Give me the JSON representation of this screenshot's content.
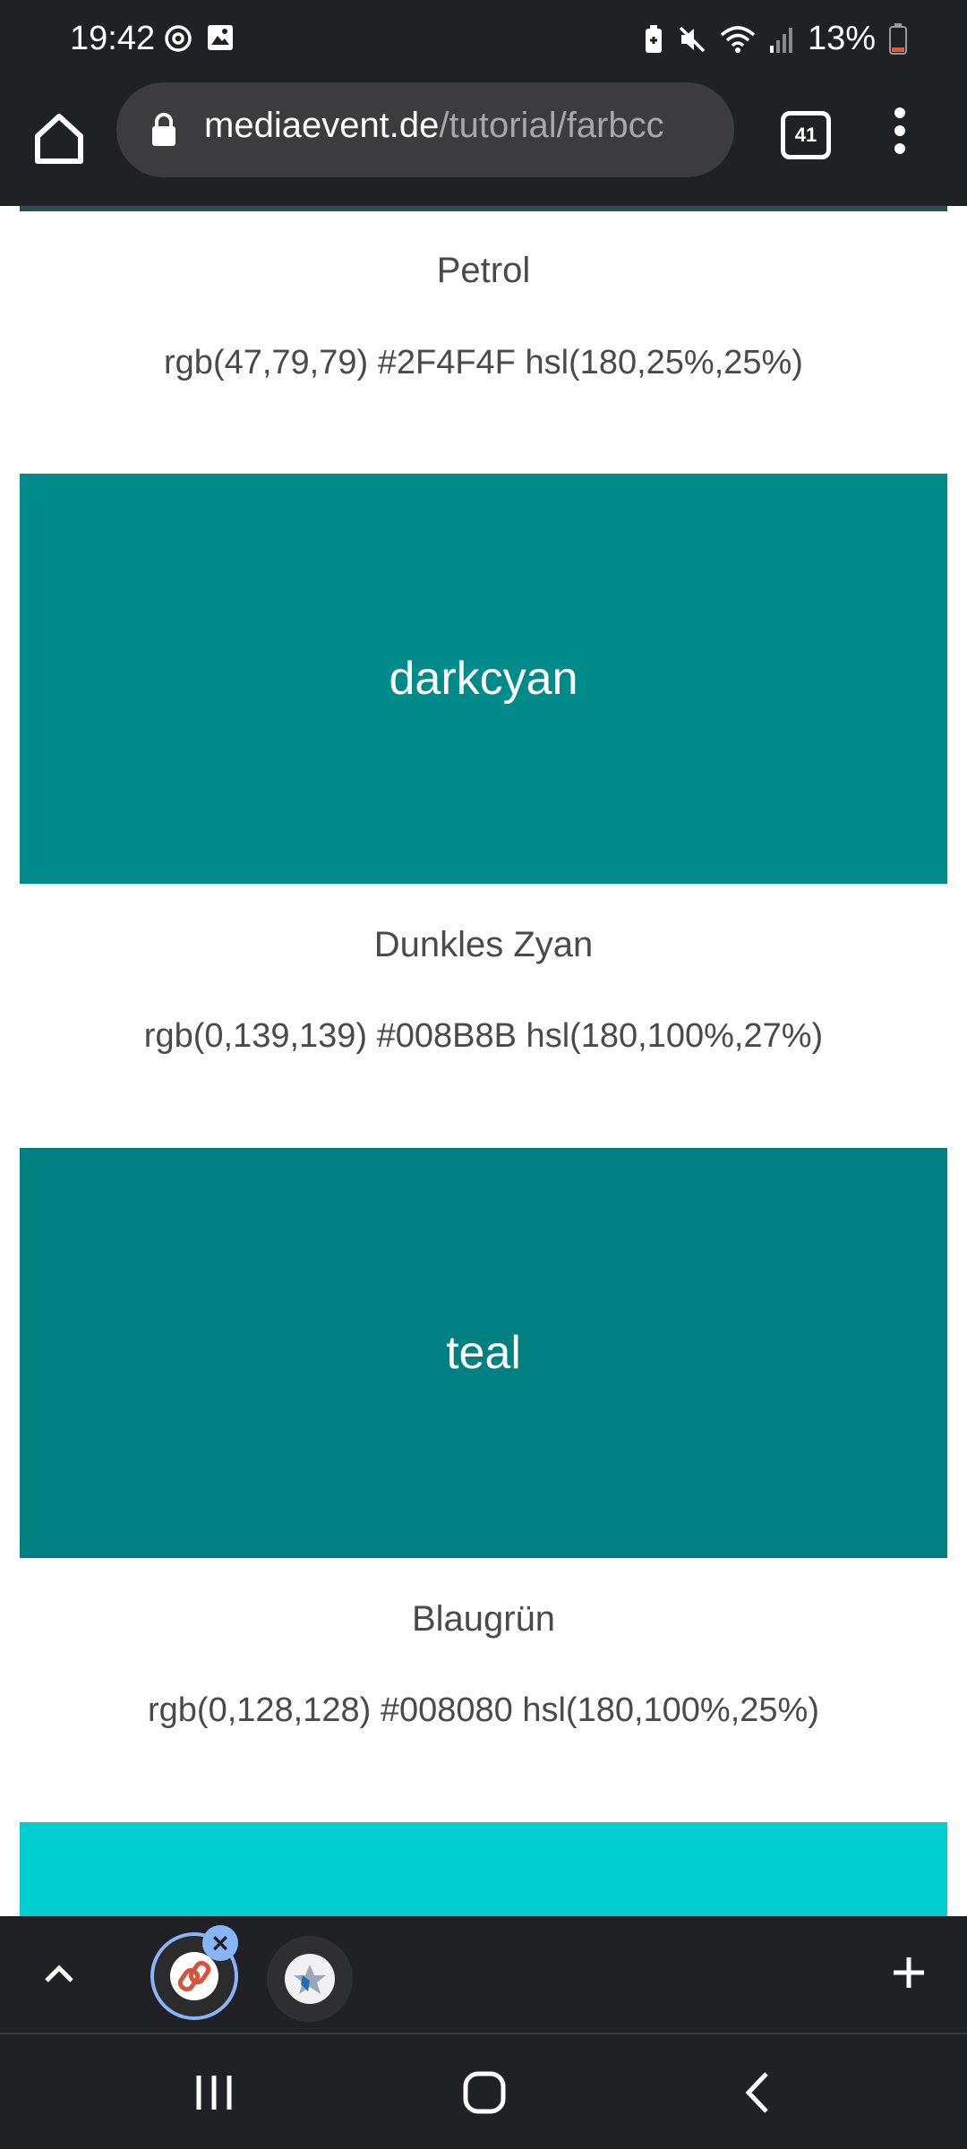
{
  "status_bar": {
    "time": "19:42",
    "battery": "13%",
    "icons": [
      "at-sign-icon",
      "image-icon",
      "battery-saver-icon",
      "mute-icon",
      "wifi-icon",
      "signal-icon",
      "battery-icon"
    ]
  },
  "browser": {
    "url_host": "mediaevent.de",
    "url_path": "/tutorial/farbcc",
    "tab_count": "41"
  },
  "colors": [
    {
      "swatch_label": "",
      "swatch_hex": "#2F4F4F",
      "name": "Petrol",
      "values": "rgb(47,79,79) #2F4F4F hsl(180,25%,25%)"
    },
    {
      "swatch_label": "darkcyan",
      "swatch_hex": "#008B8B",
      "name": "Dunkles Zyan",
      "values": "rgb(0,139,139) #008B8B hsl(180,100%,27%)"
    },
    {
      "swatch_label": "teal",
      "swatch_hex": "#008080",
      "name": "Blaugrün",
      "values": "rgb(0,128,128) #008080 hsl(180,100%,25%)"
    },
    {
      "swatch_label": "",
      "swatch_hex": "#00CED1",
      "name": "",
      "values": ""
    }
  ],
  "theme": {
    "bar_bg": "#202124",
    "accent": "#8ab4f8"
  }
}
